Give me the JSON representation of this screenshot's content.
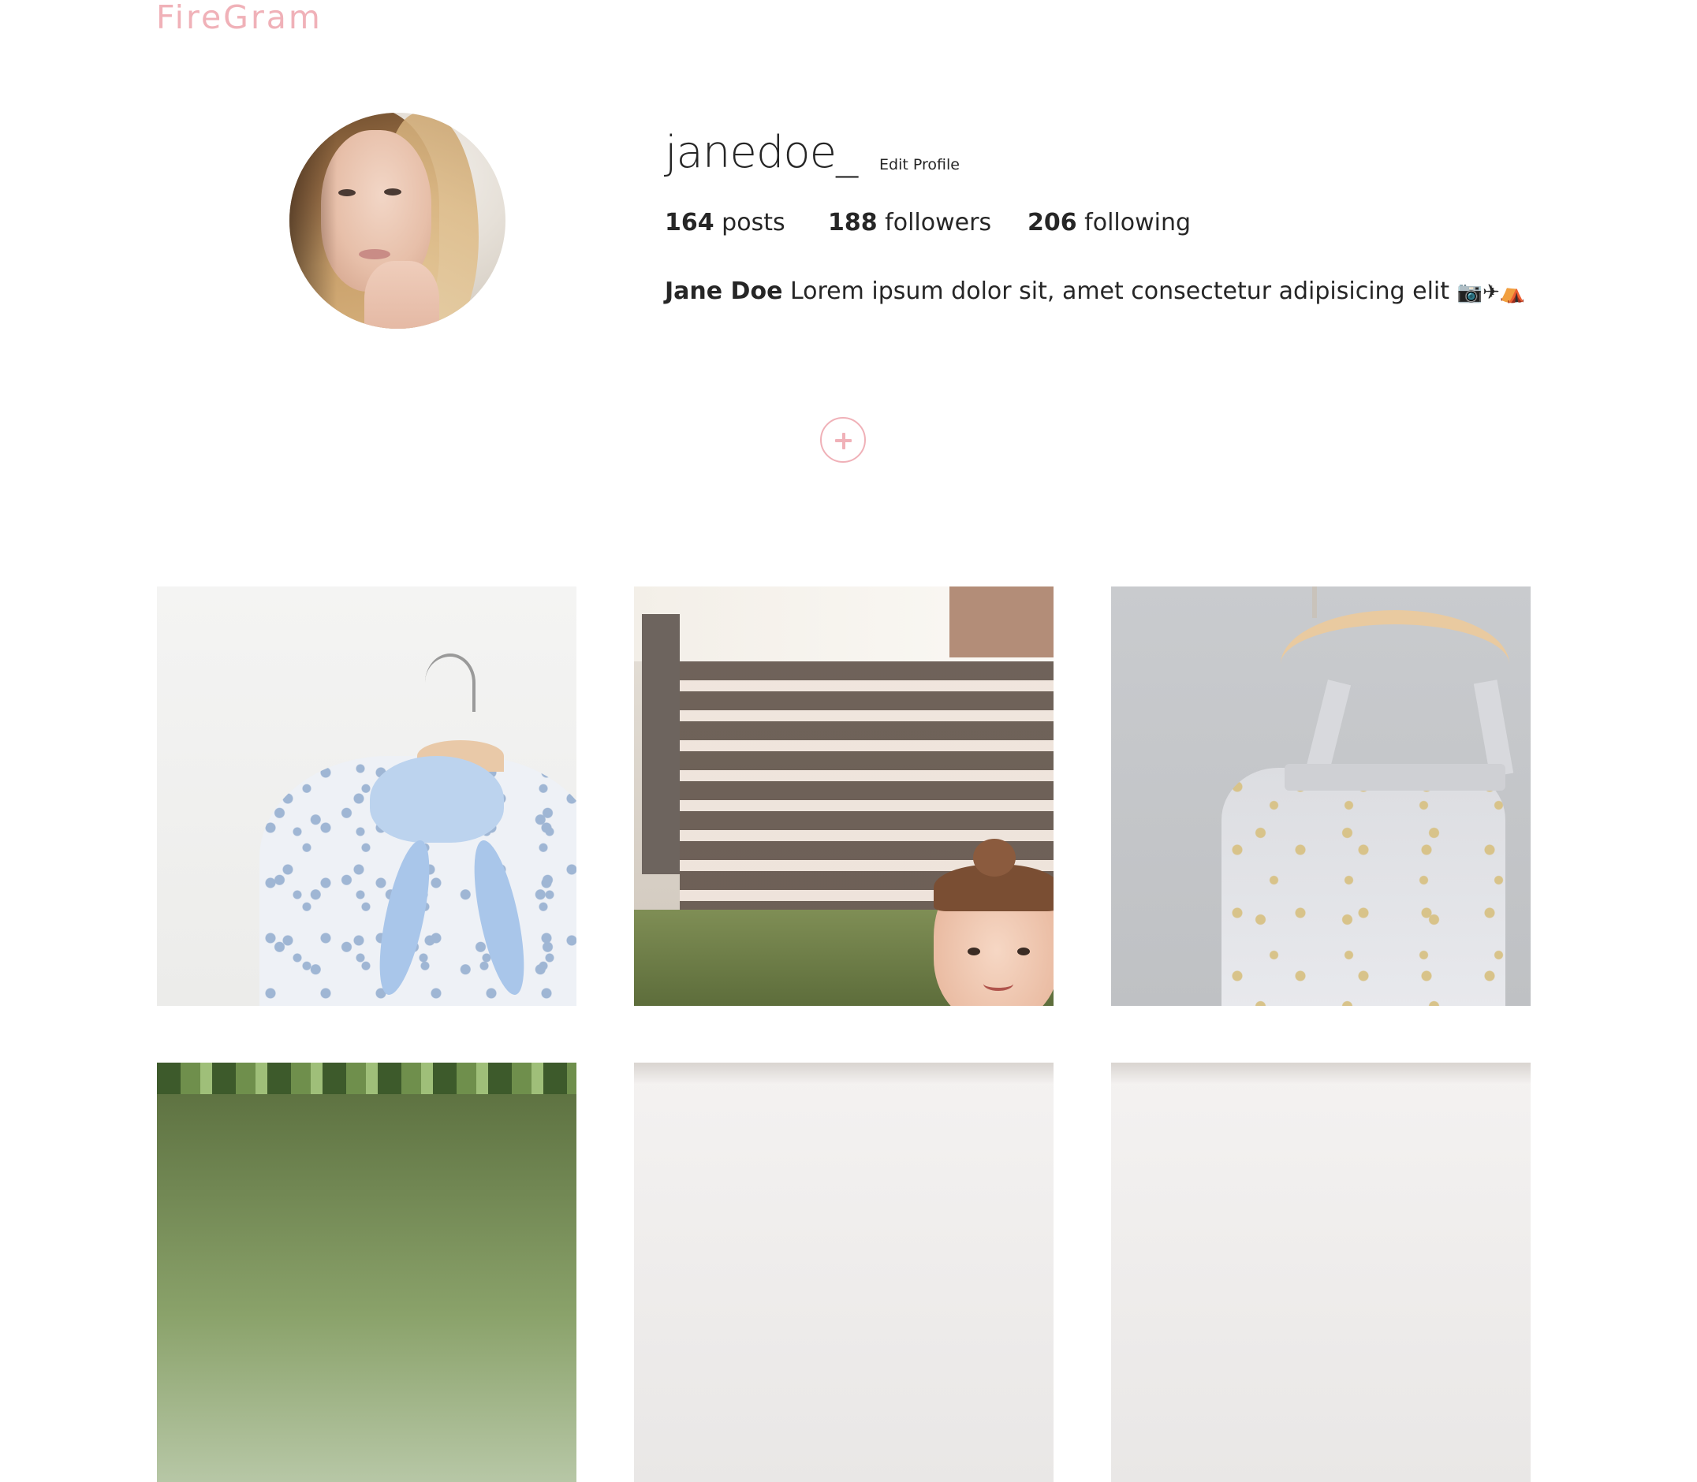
{
  "header": {
    "brand": "FireGram",
    "brand_color": "#f0b1b8"
  },
  "profile": {
    "username": "janedoe_",
    "edit_label": "Edit Profile",
    "stats": [
      {
        "count": "164",
        "label": "posts"
      },
      {
        "count": "188",
        "label": "followers"
      },
      {
        "count": "206",
        "label": "following"
      }
    ],
    "bio": {
      "name": "Jane Doe",
      "text": "Lorem ipsum dolor sit, amet consectetur adipisicing elit",
      "emojis": "📷✈⛺"
    }
  },
  "actions": {
    "add_icon": "plus-icon",
    "add_color": "#f0b1b8"
  },
  "posts": [
    {
      "id": "post-1",
      "subject": "floral-hooded-jacket"
    },
    {
      "id": "post-2",
      "subject": "child-by-fence"
    },
    {
      "id": "post-3",
      "subject": "tulle-dress-on-hanger"
    },
    {
      "id": "post-4",
      "subject": "palm-trees"
    },
    {
      "id": "post-5",
      "subject": "light-photo"
    },
    {
      "id": "post-6",
      "subject": "light-photo"
    }
  ]
}
